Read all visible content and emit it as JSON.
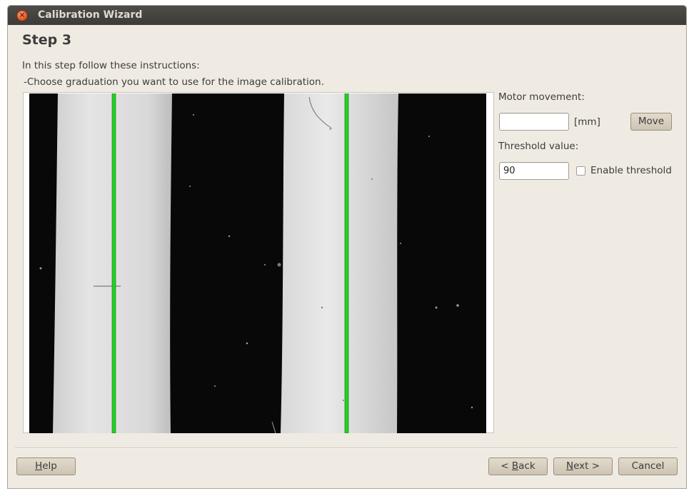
{
  "window": {
    "title": "Calibration Wizard"
  },
  "step": {
    "title": "Step 3",
    "instruction_intro": "In this step follow these instructions:",
    "instruction_detail": "-Choose graduation you want to use for the image calibration."
  },
  "controls": {
    "motor_label": "Motor movement:",
    "motor_value": "",
    "motor_unit": "[mm]",
    "move_button": "Move",
    "threshold_label": "Threshold value:",
    "threshold_value": "90",
    "enable_threshold_label": "Enable threshold",
    "enable_threshold_checked": false
  },
  "buttons": {
    "help": {
      "mnemonic": "H",
      "rest": "elp"
    },
    "back": {
      "prefix": "< ",
      "mnemonic": "B",
      "rest": "ack"
    },
    "next": {
      "mnemonic": "N",
      "rest": "ext >"
    },
    "cancel": "Cancel"
  },
  "colors": {
    "marker_line": "#22d322",
    "window_bg": "#f0ebe2"
  },
  "icons": {
    "close": "close-icon"
  }
}
